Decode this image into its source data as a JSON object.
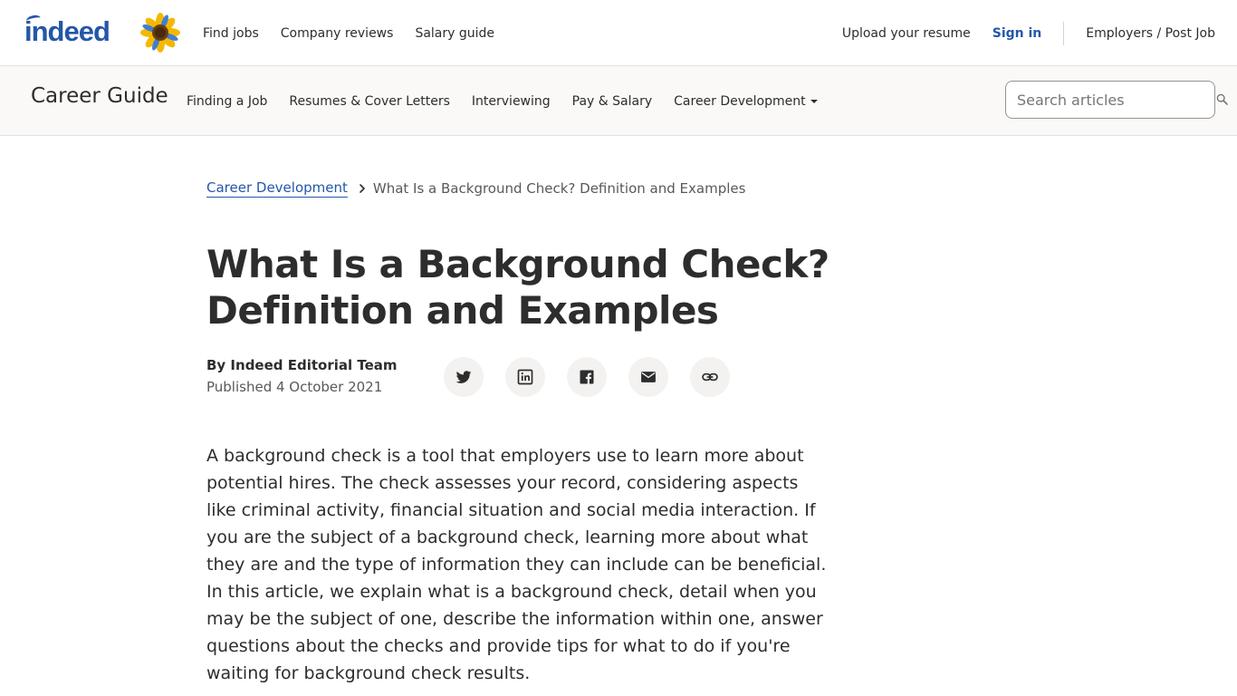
{
  "brand": {
    "logo_text": "indeed"
  },
  "top_nav": {
    "find_jobs": "Find jobs",
    "company_reviews": "Company reviews",
    "salary_guide": "Salary guide",
    "upload_resume": "Upload your resume",
    "sign_in": "Sign in",
    "employers": "Employers / Post Job"
  },
  "sub_header": {
    "title": "Career Guide",
    "nav": {
      "finding_job": "Finding a Job",
      "resumes": "Resumes & Cover Letters",
      "interviewing": "Interviewing",
      "pay_salary": "Pay & Salary",
      "career_dev": "Career Development"
    },
    "search_placeholder": "Search articles"
  },
  "breadcrumb": {
    "parent": "Career Development",
    "current": "What Is a Background Check? Definition and Examples"
  },
  "article": {
    "title": "What Is a Background Check? Definition and Examples",
    "author": "By Indeed Editorial Team",
    "published": "Published 4 October 2021",
    "intro": "A background check is a tool that employers use to learn more about potential hires. The check assesses your record, considering aspects like criminal activity, financial situation and social media interaction. If you are the subject of a background check, learning more about what they are and the type of information they can include can be beneficial. In this article, we explain what is a background check, detail when you may be the subject of one, describe the information within one, answer questions about the checks and provide tips for what to do if you're waiting for background check results."
  },
  "share_icons": [
    "twitter-icon",
    "linkedin-icon",
    "facebook-icon",
    "email-icon",
    "link-icon"
  ],
  "colors": {
    "brand_blue": "#2557a7",
    "text": "#2d2d2d",
    "muted": "#595959",
    "subheader_bg": "#faf9f8"
  }
}
